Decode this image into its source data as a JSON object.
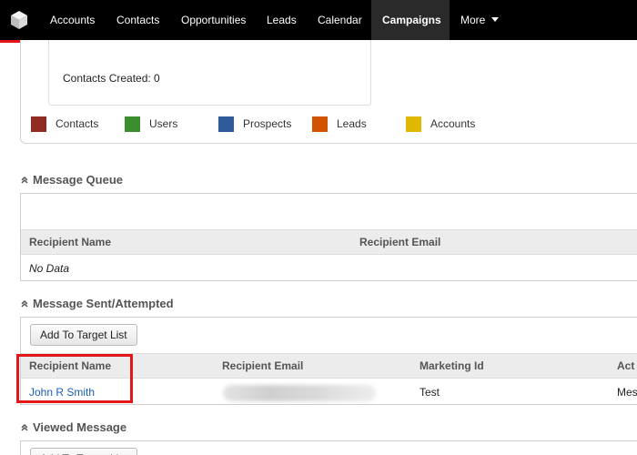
{
  "nav": {
    "logo_icon": "cube-logo-icon",
    "items": [
      "Accounts",
      "Contacts",
      "Opportunities",
      "Leads",
      "Calendar",
      "Campaigns",
      "More"
    ],
    "active": "Campaigns",
    "accent_color": "#e4141b"
  },
  "chart_panel": {
    "contacts_created": "Contacts Created: 0",
    "legend": [
      {
        "label": "Contacts",
        "color": "#922b21"
      },
      {
        "label": "Users",
        "color": "#3c8d2f"
      },
      {
        "label": "Prospects",
        "color": "#2e5b9a"
      },
      {
        "label": "Leads",
        "color": "#d35400"
      },
      {
        "label": "Accounts",
        "color": "#e1b800"
      }
    ]
  },
  "message_queue": {
    "title": "Message Queue",
    "columns": [
      "Recipient Name",
      "Recipient Email"
    ],
    "empty_text": "No Data"
  },
  "message_sent": {
    "title": "Message Sent/Attempted",
    "button": "Add To Target List",
    "columns": [
      "Recipient Name",
      "Recipient Email",
      "Marketing Id",
      "Act"
    ],
    "rows": [
      {
        "name": "John R Smith",
        "email": "",
        "marketing_id": "Test",
        "action": "Mes"
      }
    ]
  },
  "viewed_message": {
    "title": "Viewed Message",
    "button": "Add To Target List"
  }
}
